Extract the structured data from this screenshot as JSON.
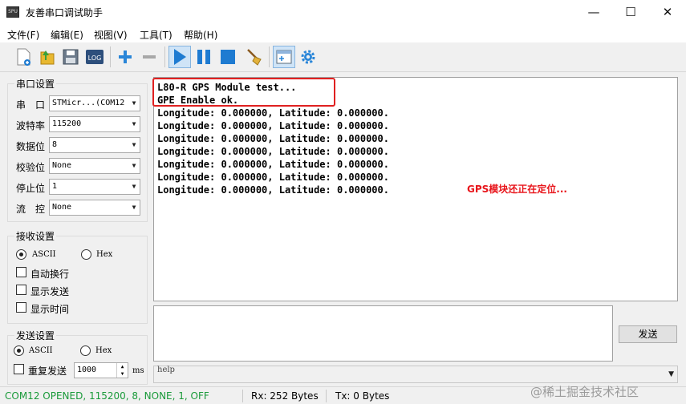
{
  "window": {
    "title": "友善串口调试助手",
    "app_icon_text": "SPU",
    "minimize_glyph": "—",
    "maximize_glyph": "☐",
    "close_glyph": "✕"
  },
  "menu": [
    "文件(F)",
    "编辑(E)",
    "视图(V)",
    "工具(T)",
    "帮助(H)"
  ],
  "toolbar": {
    "icons": [
      "new-icon",
      "open-icon",
      "save-icon",
      "log-icon",
      "add-icon",
      "remove-icon",
      "play-icon",
      "pause-icon",
      "stop-icon",
      "clear-icon",
      "window-icon",
      "settings-icon"
    ],
    "log_label": "LOG"
  },
  "serial_settings": {
    "title": "串口设置",
    "port_label": "串　口",
    "port_value": "STMicr...(COM12",
    "baud_label": "波特率",
    "baud_value": "115200",
    "databits_label": "数据位",
    "databits_value": "8",
    "parity_label": "校验位",
    "parity_value": "None",
    "stopbits_label": "停止位",
    "stopbits_value": "1",
    "flow_label": "流　控",
    "flow_value": "None"
  },
  "receive_settings": {
    "title": "接收设置",
    "ascii_label": "ASCII",
    "hex_label": "Hex",
    "auto_newline_label": "自动换行",
    "show_send_label": "显示发送",
    "show_time_label": "显示时间"
  },
  "send_settings": {
    "title": "发送设置",
    "ascii_label": "ASCII",
    "hex_label": "Hex",
    "repeat_label": "重复发送",
    "interval_value": "1000",
    "interval_unit": "ms"
  },
  "receive_area": {
    "text": "L80-R GPS Module test...\nGPE Enable ok.\nLongitude: 0.000000, Latitude: 0.000000.\nLongitude: 0.000000, Latitude: 0.000000.\nLongitude: 0.000000, Latitude: 0.000000.\nLongitude: 0.000000, Latitude: 0.000000.\nLongitude: 0.000000, Latitude: 0.000000.\nLongitude: 0.000000, Latitude: 0.000000.\nLongitude: 0.000000, Latitude: 0.000000."
  },
  "annotation": "GPS模块还正在定位...",
  "send_button": "发送",
  "help_text": "help",
  "status": {
    "port_status": "COM12 OPENED, 115200, 8, NONE, 1, OFF",
    "rx": "Rx: 252 Bytes",
    "tx": "Tx: 0 Bytes"
  },
  "watermark": "@稀土掘金技术社区",
  "colors": {
    "annotation_red": "#e8151b",
    "status_green": "#1a9a3a",
    "accent_blue": "#1e7bd1"
  }
}
